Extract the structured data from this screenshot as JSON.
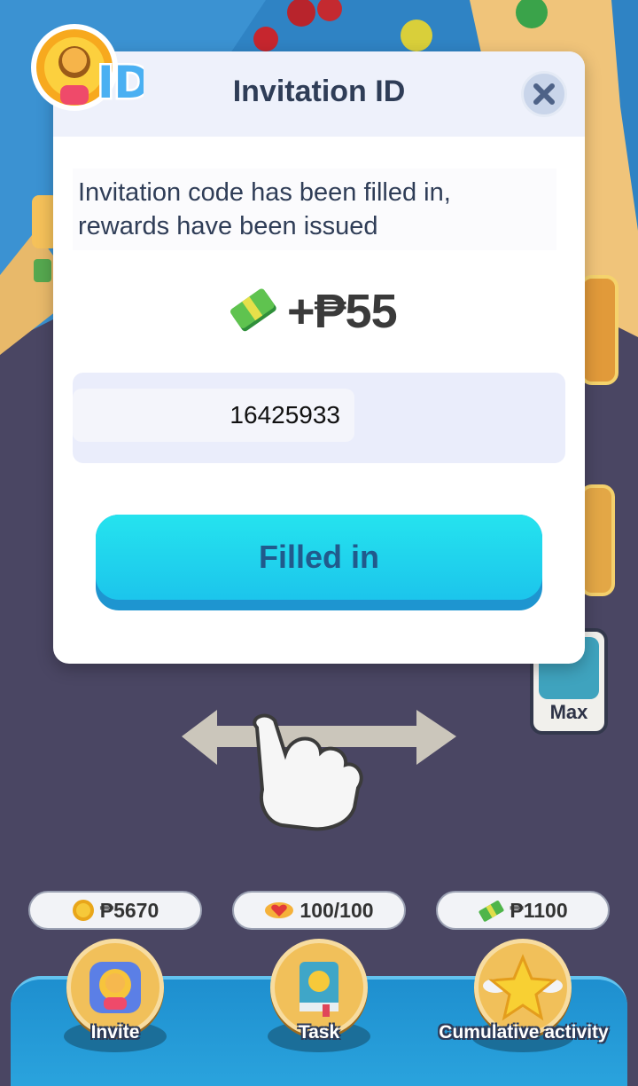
{
  "modal": {
    "title": "Invitation ID",
    "badge_label": "ID",
    "message": "Invitation code has been filled in, rewards have been issued",
    "reward": "+₱55",
    "code_value": "16425933",
    "fill_button_label": "Filled in"
  },
  "game": {
    "max_button_label": "Max"
  },
  "bottom": {
    "stats": [
      {
        "value": "₱5670",
        "icon": "coin-icon"
      },
      {
        "value": "100/100",
        "icon": "heart-icon"
      },
      {
        "value": "₱1100",
        "icon": "cash-icon"
      }
    ],
    "nav": [
      {
        "label": "Invite",
        "icon": "invite-icon"
      },
      {
        "label": "Task",
        "icon": "book-icon"
      },
      {
        "label": "Cumulative activity",
        "icon": "star-icon"
      }
    ]
  },
  "colors": {
    "accent": "#1cc5ec",
    "title": "#2f3d57",
    "background": "#4a4663"
  }
}
